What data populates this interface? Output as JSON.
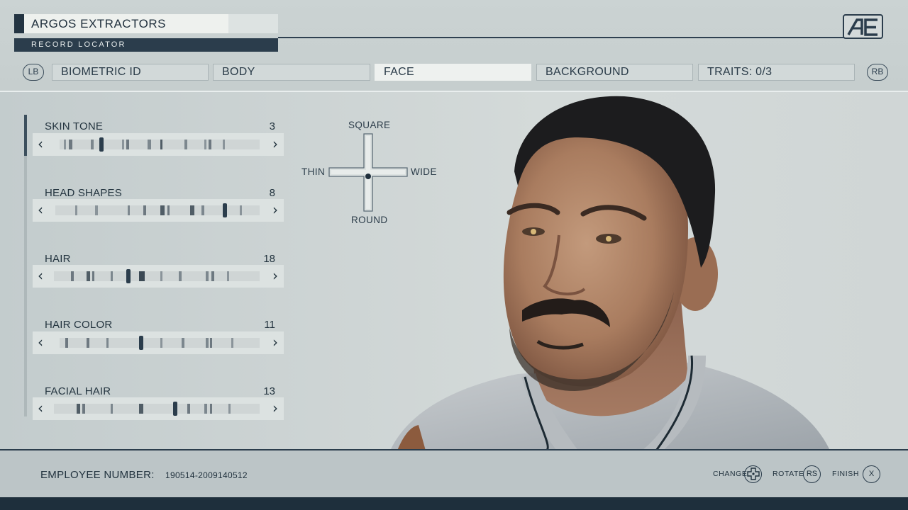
{
  "header": {
    "company": "ARGOS EXTRACTORS",
    "subtitle": "RECORD LOCATOR",
    "logo": "AE"
  },
  "tabs": {
    "left_bumper": "LB",
    "right_bumper": "RB",
    "items": [
      {
        "label": "BIOMETRIC ID",
        "active": false
      },
      {
        "label": "BODY",
        "active": false
      },
      {
        "label": "FACE",
        "active": true
      },
      {
        "label": "BACKGROUND",
        "active": false
      },
      {
        "label": "TRAITS: 0/3",
        "active": false
      }
    ]
  },
  "sliders": [
    {
      "label": "SKIN TONE",
      "value": "3"
    },
    {
      "label": "HEAD SHAPES",
      "value": "8"
    },
    {
      "label": "HAIR",
      "value": "18"
    },
    {
      "label": "HAIR COLOR",
      "value": "11"
    },
    {
      "label": "FACIAL HAIR",
      "value": "13"
    }
  ],
  "face_pad": {
    "top": "SQUARE",
    "bottom": "ROUND",
    "left": "THIN",
    "right": "WIDE"
  },
  "footer": {
    "employee_label": "EMPLOYEE NUMBER:",
    "employee_number": "190514-2009140512",
    "hints": [
      {
        "label": "CHANGE",
        "button": "dpad-icon"
      },
      {
        "label": "ROTATE",
        "button": "RS"
      },
      {
        "label": "FINISH",
        "button": "X"
      }
    ]
  },
  "colors": {
    "accent": "#2b3d4c",
    "background": "#cdd4d4",
    "active_tab": "#eef1ef"
  }
}
